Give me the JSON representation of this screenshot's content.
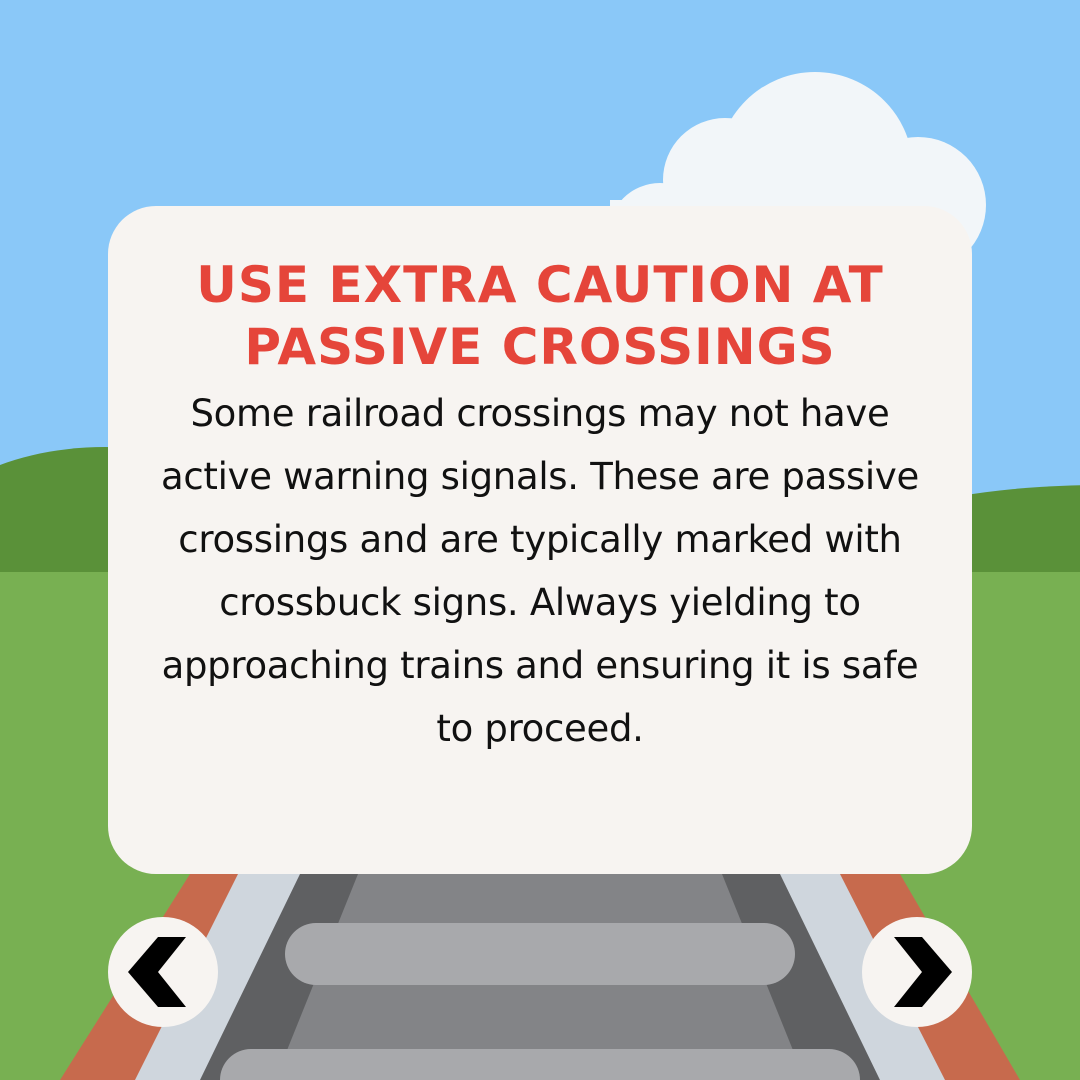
{
  "card": {
    "title": "USE EXTRA CAUTION AT PASSIVE CROSSINGS",
    "body": "Some railroad crossings may not have active warning signals. These are passive crossings and are typically marked with crossbuck signs. Always yielding to approaching trains and ensuring it is safe to proceed."
  },
  "navigation": {
    "previous_icon": "chevron-left-icon",
    "next_icon": "chevron-right-icon"
  },
  "colors": {
    "sky": "#8ac8f8",
    "cloud": "#f2f6f9",
    "hill": "#5a9139",
    "grass": "#78b052",
    "card": "#f7f4f1",
    "title": "#e5453a",
    "text": "#111111",
    "rail_brown": "#c76a4d",
    "rail_light": "#cfd6dd",
    "track_dark": "#5f6062",
    "track_mid": "#838487",
    "sleeper": "#a8a9ac"
  }
}
